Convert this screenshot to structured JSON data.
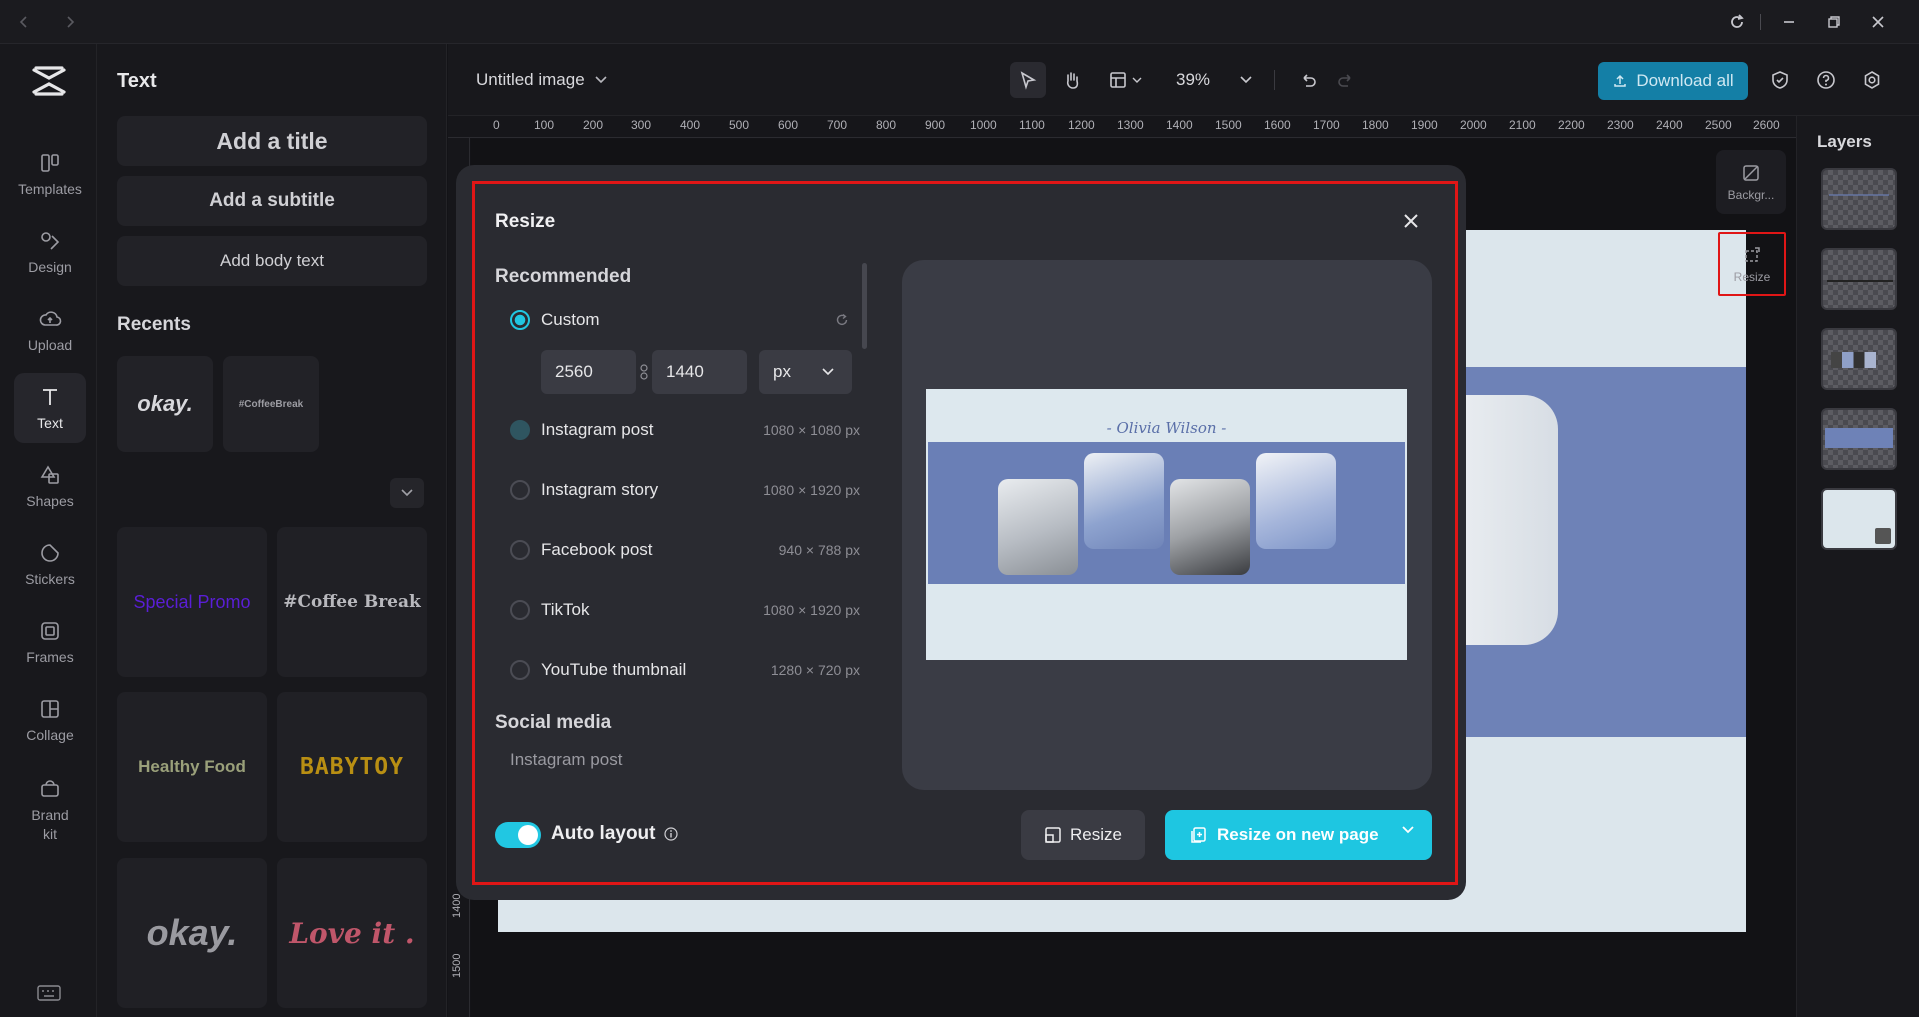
{
  "app": {
    "doc_title": "Untitled image",
    "zoom": "39%",
    "download_label": "Download all"
  },
  "rail": {
    "items": [
      {
        "label": "Templates"
      },
      {
        "label": "Design"
      },
      {
        "label": "Upload"
      },
      {
        "label": "Text"
      },
      {
        "label": "Shapes"
      },
      {
        "label": "Stickers"
      },
      {
        "label": "Frames"
      },
      {
        "label": "Collage"
      },
      {
        "label": "Brand kit"
      }
    ]
  },
  "panel": {
    "title": "Text",
    "add_title": "Add a title",
    "add_subtitle": "Add a subtitle",
    "add_body": "Add body text",
    "recents_label": "Recents",
    "recents": [
      "okay.",
      "#CoffeeBreak"
    ],
    "styles": [
      "Special Promo",
      "#Coffee Break",
      "Healthy Food",
      "BABYTOY",
      "okay.",
      "Love it ."
    ]
  },
  "ruler": {
    "h": [
      "0",
      "100",
      "200",
      "300",
      "400",
      "500",
      "600",
      "700",
      "800",
      "900",
      "1000",
      "1100",
      "1200",
      "1300",
      "1400",
      "1500",
      "1600",
      "1700",
      "1800",
      "1900",
      "2000",
      "2100",
      "2200",
      "2300",
      "2400",
      "2500",
      "2600"
    ],
    "v": [
      "1400",
      "1500"
    ]
  },
  "side": {
    "background_label": "Backgr...",
    "resize_label": "Resize"
  },
  "layers": {
    "title": "Layers"
  },
  "modal": {
    "title": "Resize",
    "recommended": "Recommended",
    "custom": {
      "label": "Custom",
      "width": "2560",
      "height": "1440",
      "unit": "px"
    },
    "options": [
      {
        "label": "Instagram post",
        "size": "1080 × 1080 px"
      },
      {
        "label": "Instagram story",
        "size": "1080 × 1920 px"
      },
      {
        "label": "Facebook post",
        "size": "940 × 788 px"
      },
      {
        "label": "TikTok",
        "size": "1080 × 1920 px"
      },
      {
        "label": "YouTube thumbnail",
        "size": "1280 × 720 px"
      }
    ],
    "social_media": "Social media",
    "social_first": "Instagram post",
    "preview_signature": "- Olivia Wilson -",
    "auto_layout": "Auto layout",
    "resize_btn": "Resize",
    "resize_new_btn": "Resize on new page",
    "accent": "#1ec6e1",
    "highlight": "#e01616"
  }
}
